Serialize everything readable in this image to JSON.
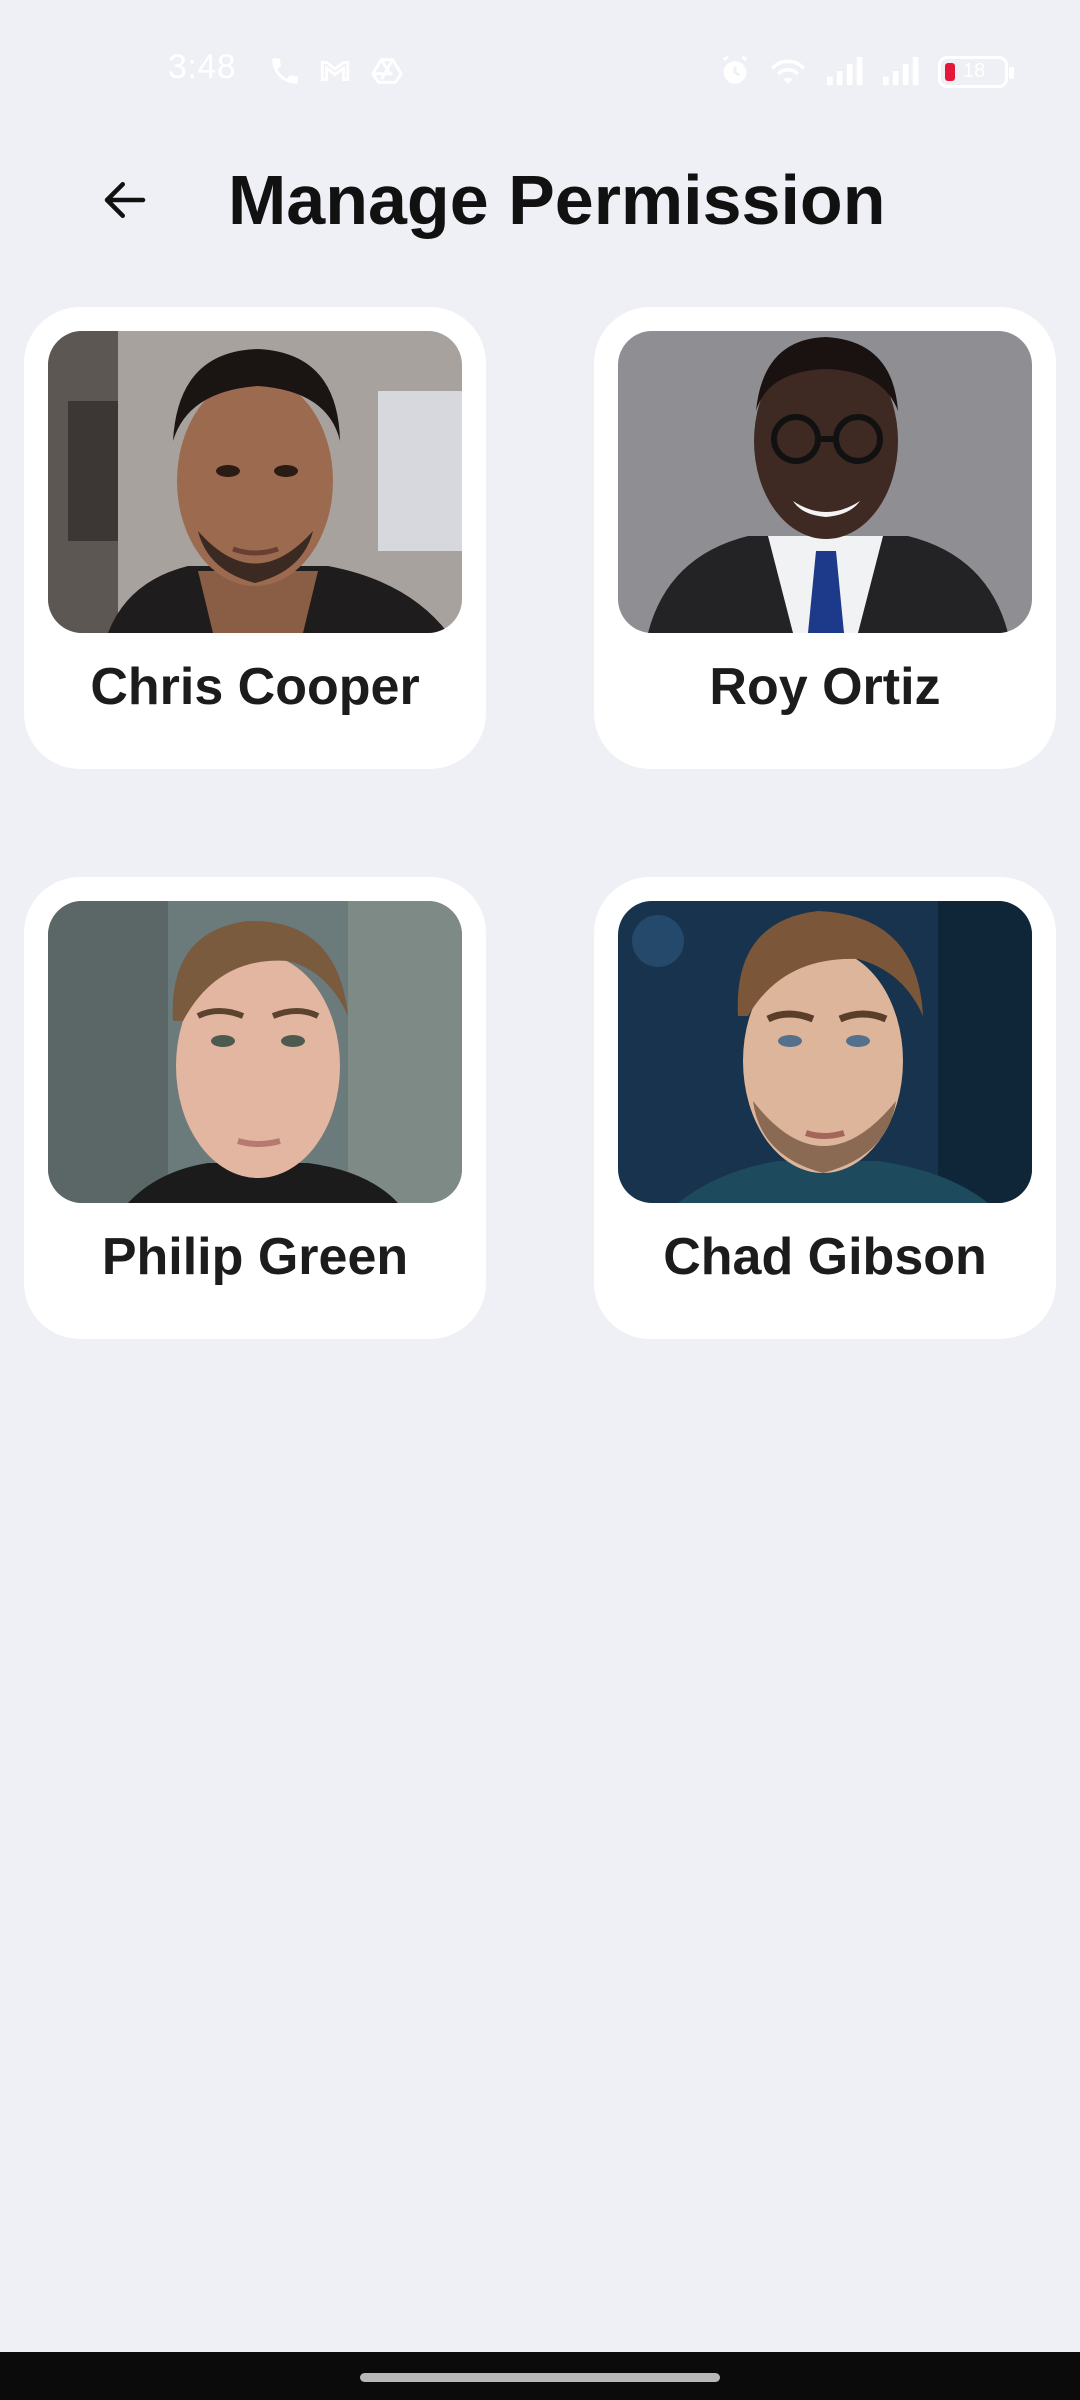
{
  "status_bar": {
    "time": "3:48",
    "battery_level": "18",
    "icons": [
      "phone-icon",
      "gmail-icon",
      "drive-icon",
      "alarm-icon",
      "wifi-icon",
      "signal-icon",
      "signal-icon",
      "battery-icon"
    ],
    "battery_color": "#E4193A"
  },
  "header": {
    "title": "Manage Permission",
    "back_icon": "arrow-left-icon"
  },
  "users": [
    {
      "name": "Chris Cooper"
    },
    {
      "name": "Roy Ortiz"
    },
    {
      "name": "Philip Green"
    },
    {
      "name": "Chad Gibson"
    }
  ],
  "colors": {
    "background": "#EFF0F5",
    "card": "#FFFFFF",
    "text": "#111111"
  }
}
